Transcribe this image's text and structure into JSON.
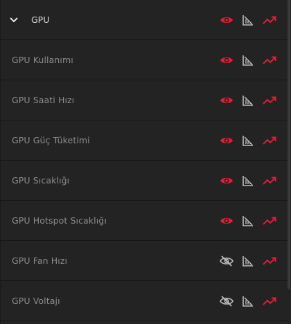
{
  "group": {
    "label": "GPU",
    "icons": {
      "visibility": "eye-icon",
      "chart_toggle": "chart-style-icon",
      "trend": "trend-up-icon"
    }
  },
  "colors": {
    "accent": "#e01e37",
    "muted_icon": "#bdbdbd",
    "label": "#8c8c8c",
    "header_label": "#d8d8d8",
    "background": "#232323"
  },
  "metrics": [
    {
      "label": "GPU Kullanımı",
      "visible": true
    },
    {
      "label": "GPU Saati Hızı",
      "visible": true
    },
    {
      "label": "GPU Güç Tüketimi",
      "visible": true
    },
    {
      "label": "GPU Sıcaklığı",
      "visible": true
    },
    {
      "label": "GPU Hotspot Sıcaklığı",
      "visible": true
    },
    {
      "label": "GPU Fan Hızı",
      "visible": false
    },
    {
      "label": "GPU Voltajı",
      "visible": false
    }
  ]
}
